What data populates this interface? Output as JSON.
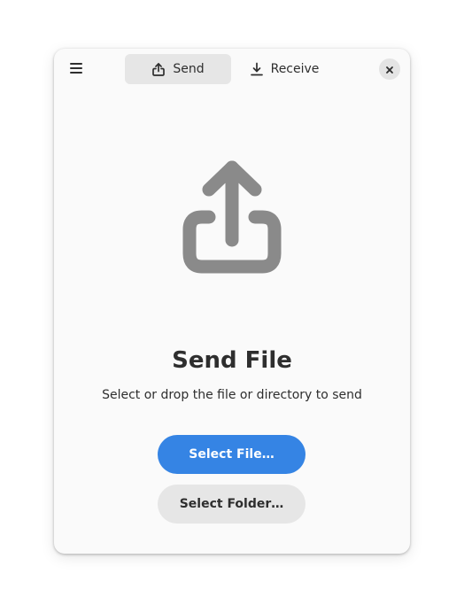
{
  "header": {
    "menu_icon": "hamburger-menu-icon",
    "tabs": [
      {
        "label": "Send",
        "icon": "share-upload-icon",
        "active": true
      },
      {
        "label": "Receive",
        "icon": "download-icon",
        "active": false
      }
    ],
    "close_icon": "close-icon"
  },
  "status": {
    "icon": "share-upload-icon",
    "title": "Send File",
    "description": "Select or drop the file or directory to send"
  },
  "actions": {
    "select_file_label": "Select File…",
    "select_folder_label": "Select Folder…"
  },
  "colors": {
    "accent": "#3584e4",
    "window_bg": "#fafafa",
    "icon_gray": "#8a8a8a"
  }
}
